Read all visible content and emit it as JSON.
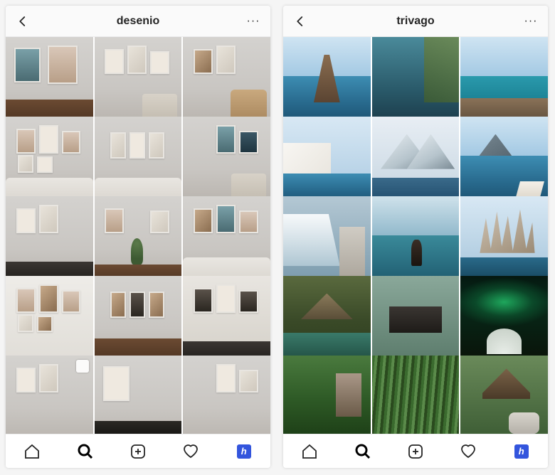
{
  "screens": [
    {
      "title": "desenio",
      "more": "···",
      "app_badge": "h",
      "tiles": [
        {
          "name": "grid-tile-1",
          "multi": false
        },
        {
          "name": "grid-tile-2",
          "multi": false
        },
        {
          "name": "grid-tile-3",
          "multi": false
        },
        {
          "name": "grid-tile-4",
          "multi": false
        },
        {
          "name": "grid-tile-5",
          "multi": false
        },
        {
          "name": "grid-tile-6",
          "multi": false
        },
        {
          "name": "grid-tile-7",
          "multi": false
        },
        {
          "name": "grid-tile-8",
          "multi": false
        },
        {
          "name": "grid-tile-9",
          "multi": false
        },
        {
          "name": "grid-tile-10",
          "multi": false
        },
        {
          "name": "grid-tile-11",
          "multi": false
        },
        {
          "name": "grid-tile-12",
          "multi": false
        },
        {
          "name": "grid-tile-13",
          "multi": true
        },
        {
          "name": "grid-tile-14",
          "multi": false
        },
        {
          "name": "grid-tile-15",
          "multi": false
        }
      ]
    },
    {
      "title": "trivago",
      "more": "···",
      "app_badge": "h",
      "tiles": [
        {
          "name": "grid-tile-1",
          "multi": false
        },
        {
          "name": "grid-tile-2",
          "multi": false
        },
        {
          "name": "grid-tile-3",
          "multi": false
        },
        {
          "name": "grid-tile-4",
          "multi": false
        },
        {
          "name": "grid-tile-5",
          "multi": false
        },
        {
          "name": "grid-tile-6",
          "multi": false
        },
        {
          "name": "grid-tile-7",
          "multi": false
        },
        {
          "name": "grid-tile-8",
          "multi": false
        },
        {
          "name": "grid-tile-9",
          "multi": false
        },
        {
          "name": "grid-tile-10",
          "multi": false
        },
        {
          "name": "grid-tile-11",
          "multi": false
        },
        {
          "name": "grid-tile-12",
          "multi": false
        },
        {
          "name": "grid-tile-13",
          "multi": false
        },
        {
          "name": "grid-tile-14",
          "multi": false
        },
        {
          "name": "grid-tile-15",
          "multi": false
        }
      ]
    }
  ]
}
